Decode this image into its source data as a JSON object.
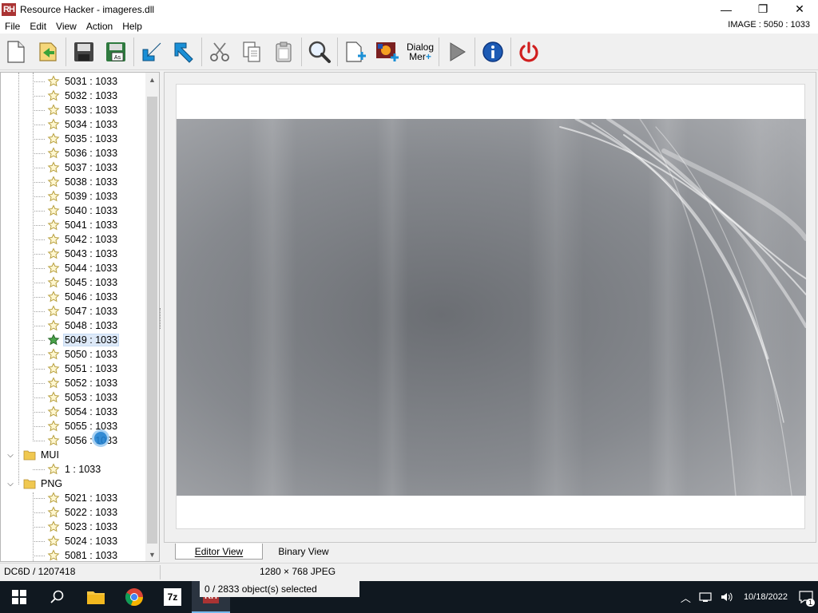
{
  "window": {
    "title": "Resource Hacker - imageres.dll",
    "app_icon_text": "RH",
    "minimize": "—",
    "restore": "❐",
    "close": "✕"
  },
  "menu": {
    "items": [
      "File",
      "Edit",
      "View",
      "Action",
      "Help"
    ],
    "resource_id": "IMAGE : 5050 : 1033"
  },
  "toolbar": {
    "buttons": [
      "new-file",
      "open-file",
      "save",
      "save-as",
      "import-arrow",
      "export-arrow",
      "cut",
      "copy",
      "paste",
      "find",
      "add-resource",
      "add-image",
      "dialog-merge",
      "run-script",
      "about",
      "exit"
    ],
    "dialog_merge_label_line1": "Dialog",
    "dialog_merge_label_line2": "Mer"
  },
  "tree": {
    "items": [
      "5031 : 1033",
      "5032 : 1033",
      "5033 : 1033",
      "5034 : 1033",
      "5035 : 1033",
      "5036 : 1033",
      "5037 : 1033",
      "5038 : 1033",
      "5039 : 1033",
      "5040 : 1033",
      "5041 : 1033",
      "5042 : 1033",
      "5043 : 1033",
      "5044 : 1033",
      "5045 : 1033",
      "5046 : 1033",
      "5047 : 1033",
      "5048 : 1033",
      "5049 : 1033",
      "5050 : 1033",
      "5051 : 1033",
      "5052 : 1033",
      "5053 : 1033",
      "5054 : 1033",
      "5055 : 1033",
      "5056 : 1033"
    ],
    "selected_item": "5049 : 1033",
    "mui_folder": "MUI",
    "mui_item": "1 : 1033",
    "png_folder": "PNG",
    "png_items": [
      "5021 : 1033",
      "5022 : 1033",
      "5023 : 1033",
      "5024 : 1033",
      "5081 : 1033"
    ]
  },
  "tabs": {
    "editor": "Editor View",
    "binary": "Binary View"
  },
  "status": {
    "offset": "DC6D / 1207418",
    "image_info": "1280 × 768  JPEG",
    "selection": "0 / 2833 object(s) selected"
  },
  "taskbar": {
    "clock": "10/18/2022",
    "notification_count": "1",
    "app_7z": "7z"
  }
}
